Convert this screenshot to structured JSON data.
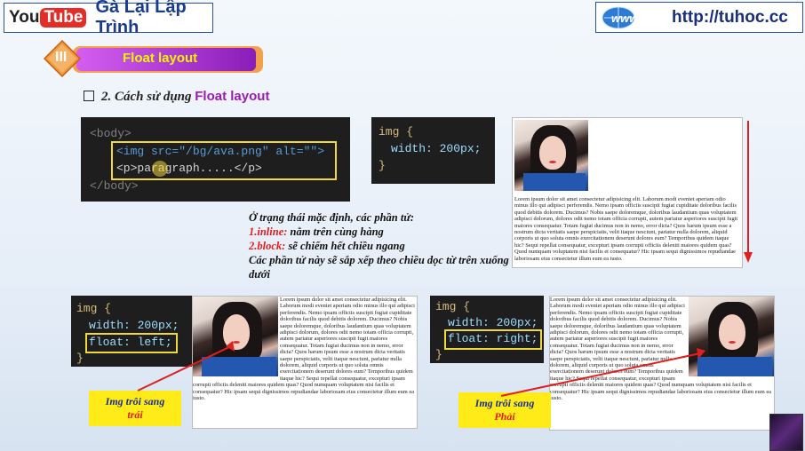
{
  "header": {
    "youtube_you": "You",
    "youtube_tube": "Tube",
    "channel": "Gà Lại Lập Trình",
    "site_url": "http://tuhoc.cc",
    "www_label": "www"
  },
  "section": {
    "number": "III",
    "title": "Float layout"
  },
  "subheading": {
    "prefix": "2. Cách sử dụng",
    "highlight": "Float layout"
  },
  "code_html": {
    "line1": "<body>",
    "line2a": "<img src=\"/bg/ava.png\" alt=\"\">",
    "line3": "<p>paragraph.....</p>",
    "line4": "</body>"
  },
  "code_css_width": {
    "sel": "img {",
    "prop": "width: 200px;",
    "close": "}"
  },
  "code_css_left": {
    "sel": "img {",
    "prop1": "width: 200px;",
    "prop2": "float: left;",
    "close": "}"
  },
  "code_css_right": {
    "sel": "img {",
    "prop1": "width: 200px;",
    "prop2": "float: right;",
    "close": "}"
  },
  "description": {
    "intro": "Ở trạng thái mặc định, các phần tử:",
    "inline_key": "1.inline:",
    "inline_val": " nằm trên cùng hàng",
    "block_key": "2.block:",
    "block_val": " sẽ chiếm hết chiều ngang",
    "outro": "Các phần tử này sẽ sắp xếp theo chiều dọc từ trên xuống dưới"
  },
  "note_left": {
    "line1": "Img trôi sang",
    "line2": "trái"
  },
  "note_right": {
    "line1": "Img trôi sang",
    "line2": "Phải"
  },
  "lorem": "Lorem ipsum dolor sit amet consectetur adipisicing elit. Laborum modi eveniet aperiam odio minus illo qui adipisci perferendis. Nemo ipsam officiis suscipit fugiat cupiditate doloribus facilis quod debitis dolorem. Ducimus? Nobis saepe doloremque, doloribus laudantium quas voluptatem adipisci dolorum, dolores odit nemo totam officia corrupti, autem pariatur asperiores suscipit fugit maiores consequatur. Totam fugiat ducimus non in nemo, error dicta? Quos harum ipsum esse a nostrum dicta veritatis saepe perspiciatis, velit itaque nesciunt, pariatur nulla dolorem, aliquid corporis ut quo soluta omnis exercitationem deserunt dolores eum? Temporibus quidem itaque hic? Sequi repellat consequatur, excepturi ipsam corrupti officiis deleniti maiores quidem quas? Quod numquam voluptatem nisi facilis et consequatur? Hic ipsam sequi dignissimos repudiandae laboriosam eius consectetur illum eum ea iusto."
}
